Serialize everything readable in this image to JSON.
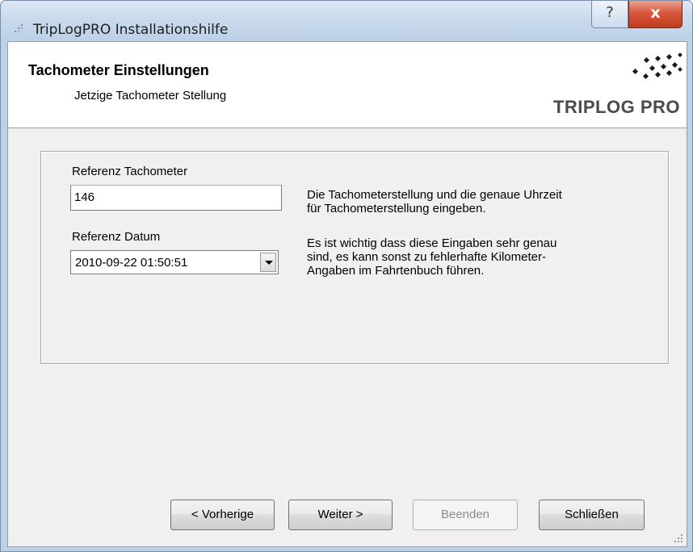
{
  "window": {
    "title": "TripLogPRO Installationshilfe",
    "help_label": "?",
    "close_label": "x"
  },
  "header": {
    "title": "Tachometer Einstellungen",
    "subtitle": "Jetzige Tachometer Stellung",
    "brand": "TRIPLOG PRO"
  },
  "form": {
    "referenz_tachometer_label": "Referenz Tachometer",
    "referenz_tachometer_value": "146",
    "referenz_datum_label": "Referenz Datum",
    "referenz_datum_value": "2010-09-22  01:50:51",
    "description_1": "Die Tachometerstellung und die genaue Uhrzeit\nfür Tachometerstellung eingeben.",
    "description_2": "Es ist wichtig dass diese Eingaben sehr genau\nsind, es kann sonst zu fehlerhafte Kilometer-\nAngaben im Fahrtenbuch führen."
  },
  "buttons": {
    "back": "< Vorherige",
    "next": "Weiter >",
    "finish": "Beenden",
    "close": "Schließen"
  },
  "icons": {
    "app": "app-icon",
    "brand_logo": "diamond-dots-logo",
    "resize": "resize-grip-icon"
  },
  "colors": {
    "titlebar": "#c8d9ec",
    "close_button": "#c13c1e",
    "client_bg": "#f0f0f0",
    "brand_text": "#4a4a4a"
  }
}
